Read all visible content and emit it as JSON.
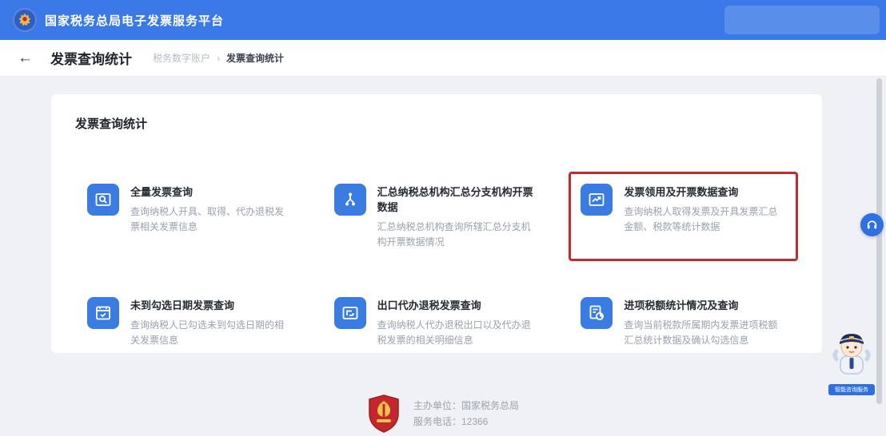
{
  "appbar": {
    "title": "国家税务总局电子发票服务平台"
  },
  "page": {
    "back_glyph": "←",
    "title": "发票查询统计",
    "breadcrumb": {
      "parent": "税务数字账户",
      "separator": "›",
      "current": "发票查询统计"
    }
  },
  "card": {
    "title": "发票查询统计",
    "tiles": [
      {
        "title": "全量发票查询",
        "desc": "查询纳税人开具、取得、代办退税发票相关发票信息",
        "icon": "invoice-search-icon",
        "highlighted": false
      },
      {
        "title": "汇总纳税总机构汇总分支机构开票数据",
        "desc": "汇总纳税总机构查询所辖汇总分支机构开票数据情况",
        "icon": "branch-data-icon",
        "highlighted": false
      },
      {
        "title": "发票领用及开票数据查询",
        "desc": "查询纳税人取得发票及开具发票汇总金额、税款等统计数据",
        "icon": "issuance-data-icon",
        "highlighted": true
      },
      {
        "title": "未到勾选日期发票查询",
        "desc": "查询纳税人已勾选未到勾选日期的相关发票信息",
        "icon": "date-invoice-icon",
        "highlighted": false
      },
      {
        "title": "出口代办退税发票查询",
        "desc": "查询纳税人代办退税出口以及代办退税发票的相关明细信息",
        "icon": "export-refund-icon",
        "highlighted": false
      },
      {
        "title": "进项税额统计情况及查询",
        "desc": "查询当前税款所属期内发票进项税额汇总统计数据及确认勾选信息",
        "icon": "input-tax-icon",
        "highlighted": false
      }
    ]
  },
  "footer": {
    "line1": "主办单位：国家税务总局",
    "line2": "服务电话：12366"
  },
  "floating": {
    "help_icon": "headset-icon",
    "mascot_label": "智能咨询服务"
  },
  "colors": {
    "header_blue": "#3b79e8",
    "icon_blue": "#3a7ce2",
    "highlight_red": "#c62a2e",
    "page_bg": "#eff1f4"
  }
}
